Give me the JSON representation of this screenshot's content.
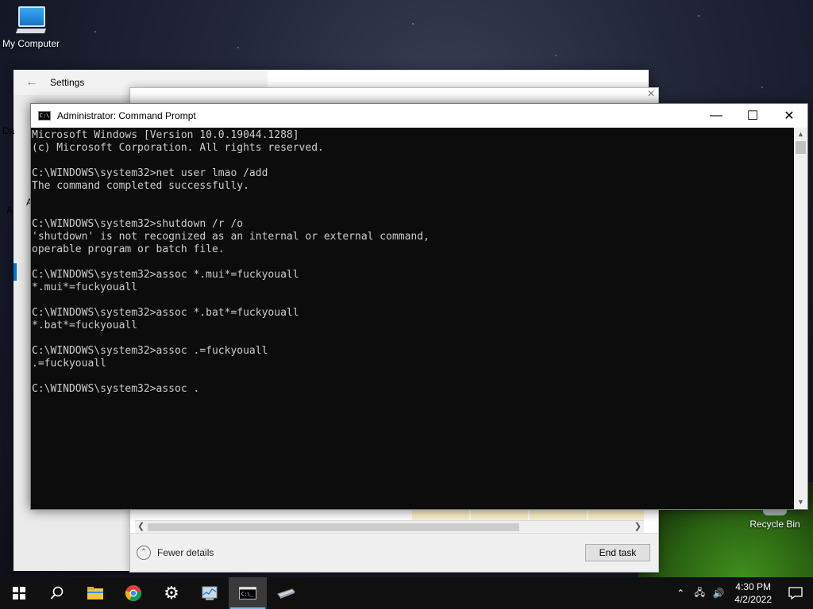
{
  "desktop": {
    "icons": [
      {
        "label": "My Computer",
        "icon": "computer-icon"
      },
      {
        "label": "Recycle Bin",
        "icon": "recycle-bin-icon"
      }
    ]
  },
  "settings_window": {
    "title": "Settings",
    "side_peek": [
      "Da",
      "A",
      "A"
    ]
  },
  "task_manager": {
    "fewer_details": "Fewer details",
    "end_task": "End task"
  },
  "cmd_window": {
    "title": "Administrator: Command Prompt",
    "lines": [
      "Microsoft Windows [Version 10.0.19044.1288]",
      "(c) Microsoft Corporation. All rights reserved.",
      "",
      "C:\\WINDOWS\\system32>net user lmao /add",
      "The command completed successfully.",
      "",
      "",
      "C:\\WINDOWS\\system32>shutdown /r /o",
      "'shutdown' is not recognized as an internal or external command,",
      "operable program or batch file.",
      "",
      "C:\\WINDOWS\\system32>assoc *.mui*=fuckyouall",
      "*.mui*=fuckyouall",
      "",
      "C:\\WINDOWS\\system32>assoc *.bat*=fuckyouall",
      "*.bat*=fuckyouall",
      "",
      "C:\\WINDOWS\\system32>assoc .=fuckyouall",
      ".=fuckyouall",
      "",
      "C:\\WINDOWS\\system32>assoc ."
    ]
  },
  "taskbar": {
    "apps": [
      "start-icon",
      "search-icon",
      "file-explorer-icon",
      "chrome-icon",
      "settings-gear-icon",
      "task-manager-icon",
      "command-prompt-icon",
      "drive-icon"
    ],
    "clock": {
      "time": "4:30 PM",
      "date": "4/2/2022"
    }
  }
}
